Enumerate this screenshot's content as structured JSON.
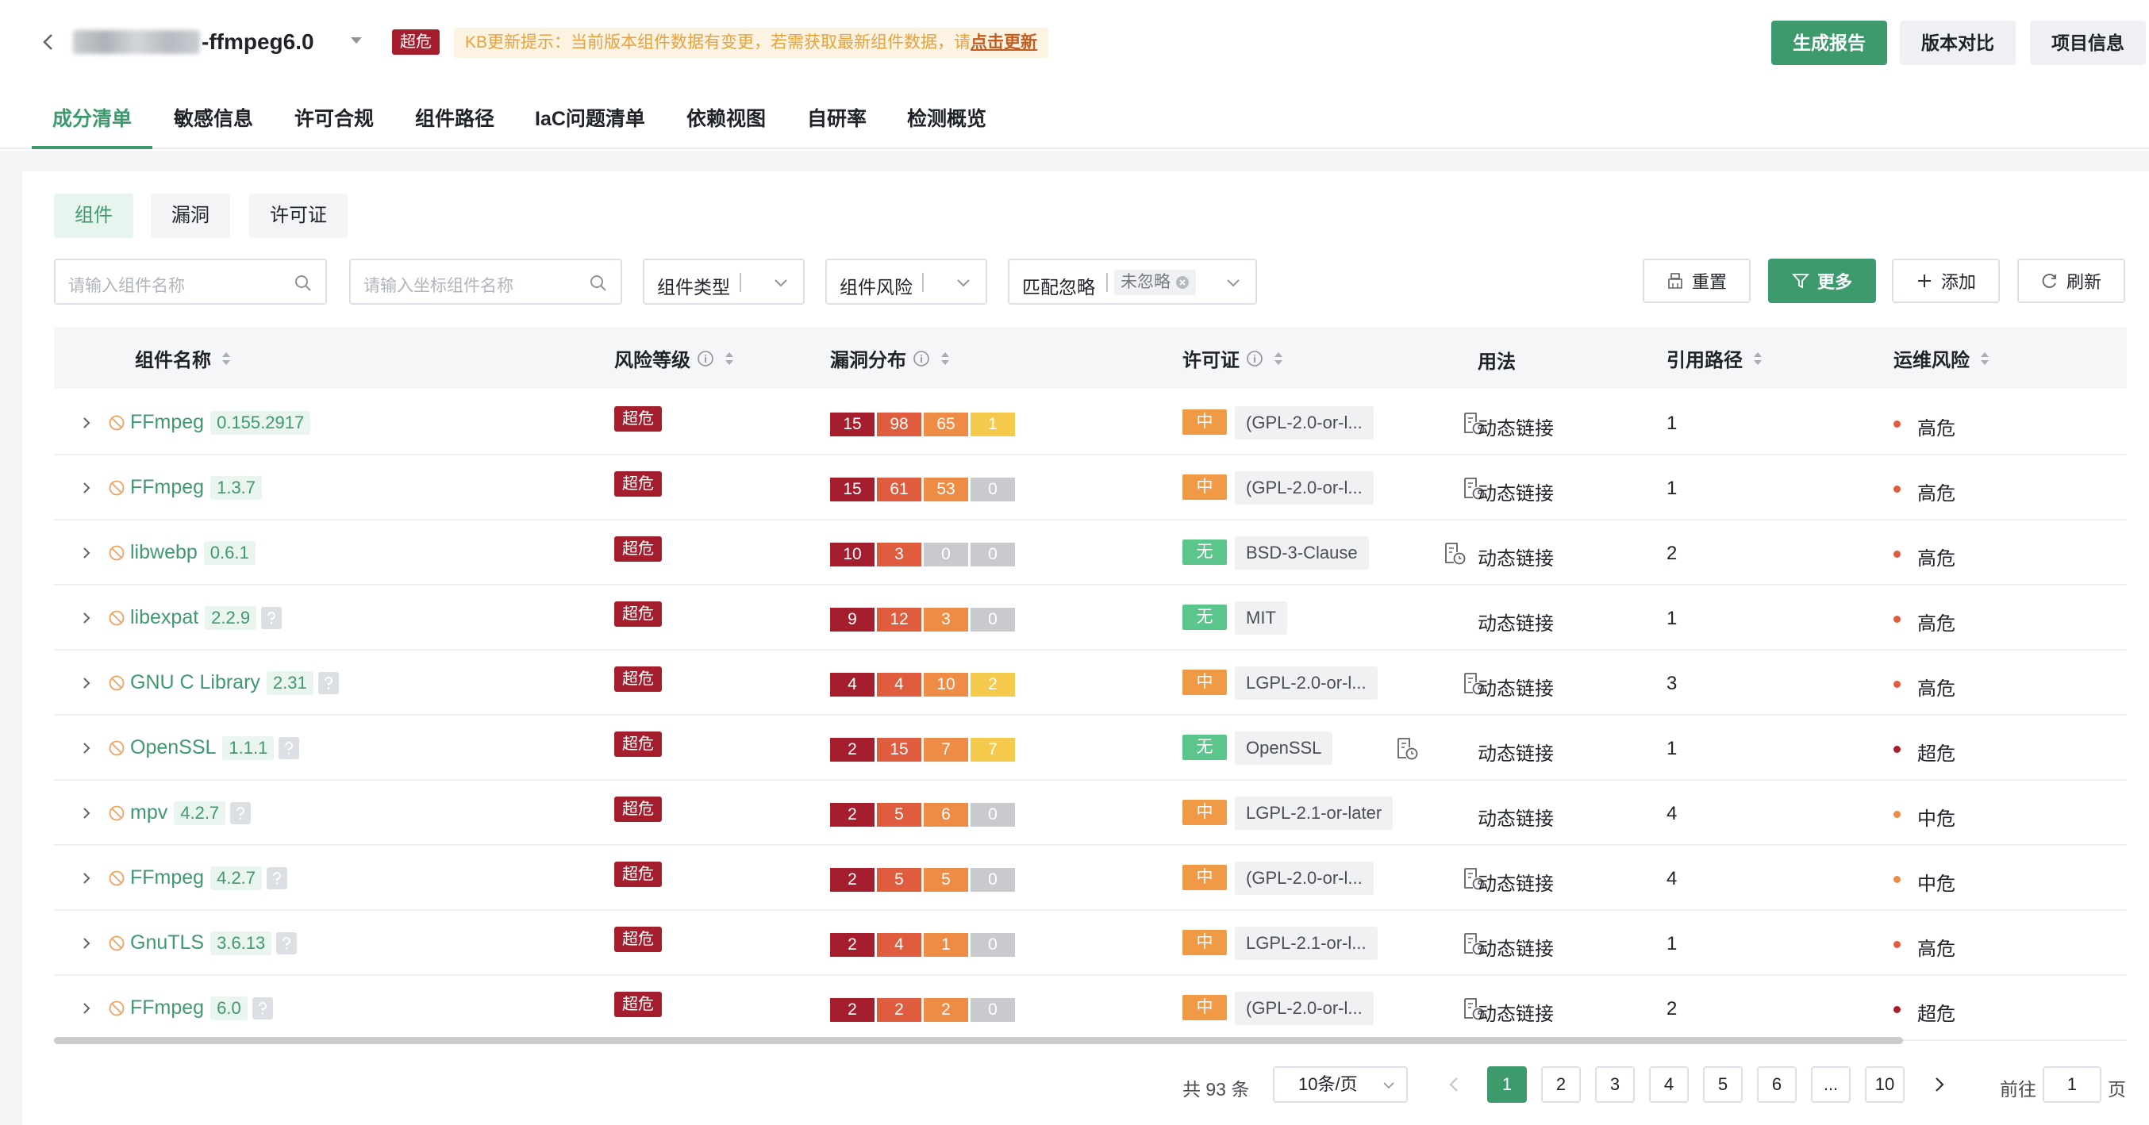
{
  "header": {
    "project_name_suffix": "-ffmpeg6.0",
    "risk_badge": "超危",
    "kb_notice_text": "KB更新提示：当前版本组件数据有变更，若需获取最新组件数据，请",
    "kb_notice_link": "点击更新",
    "buttons": {
      "report": "生成报告",
      "compare": "版本对比",
      "project_info": "项目信息"
    }
  },
  "main_tabs": [
    "成分清单",
    "敏感信息",
    "许可合规",
    "组件路径",
    "IaC问题清单",
    "依赖视图",
    "自研率",
    "检测概览"
  ],
  "sub_tabs": [
    "组件",
    "漏洞",
    "许可证"
  ],
  "filters": {
    "component_name_placeholder": "请输入组件名称",
    "coordinate_name_placeholder": "请输入坐标组件名称",
    "component_type": "组件类型",
    "component_risk": "组件风险",
    "match_ignore": "匹配忽略",
    "match_ignore_tag": "未忽略"
  },
  "toolbar": {
    "reset": "重置",
    "more": "更多",
    "add": "添加",
    "refresh": "刷新"
  },
  "table": {
    "headers": {
      "name": "组件名称",
      "risk": "风险等级",
      "vuln": "漏洞分布",
      "license": "许可证",
      "usage": "用法",
      "refpath": "引用路径",
      "ops_risk": "运维风险"
    },
    "rows": [
      {
        "name": "FFmpeg",
        "version": "0.155.2917",
        "help": false,
        "risk": "超危",
        "vuln": [
          15,
          98,
          65,
          1
        ],
        "license_level": "中",
        "license": "(GPL-2.0-or-l...",
        "doc": true,
        "usage": "动态链接",
        "refpath": "1",
        "ops": "高危"
      },
      {
        "name": "FFmpeg",
        "version": "1.3.7",
        "help": false,
        "risk": "超危",
        "vuln": [
          15,
          61,
          53,
          0
        ],
        "license_level": "中",
        "license": "(GPL-2.0-or-l...",
        "doc": true,
        "usage": "动态链接",
        "refpath": "1",
        "ops": "高危"
      },
      {
        "name": "libwebp",
        "version": "0.6.1",
        "help": false,
        "risk": "超危",
        "vuln": [
          10,
          3,
          0,
          0
        ],
        "license_level": "无",
        "license": "BSD-3-Clause",
        "doc": true,
        "usage": "动态链接",
        "refpath": "2",
        "ops": "高危"
      },
      {
        "name": "libexpat",
        "version": "2.2.9",
        "help": true,
        "risk": "超危",
        "vuln": [
          9,
          12,
          3,
          0
        ],
        "license_level": "无",
        "license": "MIT",
        "doc": false,
        "usage": "动态链接",
        "refpath": "1",
        "ops": "高危"
      },
      {
        "name": "GNU C Library",
        "version": "2.31",
        "help": true,
        "risk": "超危",
        "vuln": [
          4,
          4,
          10,
          2
        ],
        "license_level": "中",
        "license": "LGPL-2.0-or-l...",
        "doc": true,
        "usage": "动态链接",
        "refpath": "3",
        "ops": "高危"
      },
      {
        "name": "OpenSSL",
        "version": "1.1.1",
        "help": true,
        "risk": "超危",
        "vuln": [
          2,
          15,
          7,
          7
        ],
        "license_level": "无",
        "license": "OpenSSL",
        "doc": true,
        "usage": "动态链接",
        "refpath": "1",
        "ops": "超危"
      },
      {
        "name": "mpv",
        "version": "4.2.7",
        "help": true,
        "risk": "超危",
        "vuln": [
          2,
          5,
          6,
          0
        ],
        "license_level": "中",
        "license": "LGPL-2.1-or-later",
        "doc": false,
        "usage": "动态链接",
        "refpath": "4",
        "ops": "中危"
      },
      {
        "name": "FFmpeg",
        "version": "4.2.7",
        "help": true,
        "risk": "超危",
        "vuln": [
          2,
          5,
          5,
          0
        ],
        "license_level": "中",
        "license": "(GPL-2.0-or-l...",
        "doc": true,
        "usage": "动态链接",
        "refpath": "4",
        "ops": "中危"
      },
      {
        "name": "GnuTLS",
        "version": "3.6.13",
        "help": true,
        "risk": "超危",
        "vuln": [
          2,
          4,
          1,
          0
        ],
        "license_level": "中",
        "license": "LGPL-2.1-or-l...",
        "doc": true,
        "usage": "动态链接",
        "refpath": "1",
        "ops": "高危"
      },
      {
        "name": "FFmpeg",
        "version": "6.0",
        "help": true,
        "risk": "超危",
        "vuln": [
          2,
          2,
          2,
          0
        ],
        "license_level": "中",
        "license": "(GPL-2.0-or-l...",
        "doc": true,
        "usage": "动态链接",
        "refpath": "2",
        "ops": "超危"
      }
    ]
  },
  "pagination": {
    "total": "共 93 条",
    "page_size": "10条/页",
    "pages": [
      "1",
      "2",
      "3",
      "4",
      "5",
      "6",
      "...",
      "10"
    ],
    "current": "1",
    "goto_label": "前往",
    "goto_value": "1",
    "goto_suffix": "页"
  },
  "colors": {
    "accent": "#3d9a6c",
    "critical": "#a41e2d",
    "high": "#e05c3e",
    "medium": "#ee8b45",
    "low": "#f5c94c",
    "zero": "#c8cacd",
    "ops_high": "#e05c3e",
    "ops_critical": "#a41e2d",
    "ops_medium": "#ee8b45"
  }
}
